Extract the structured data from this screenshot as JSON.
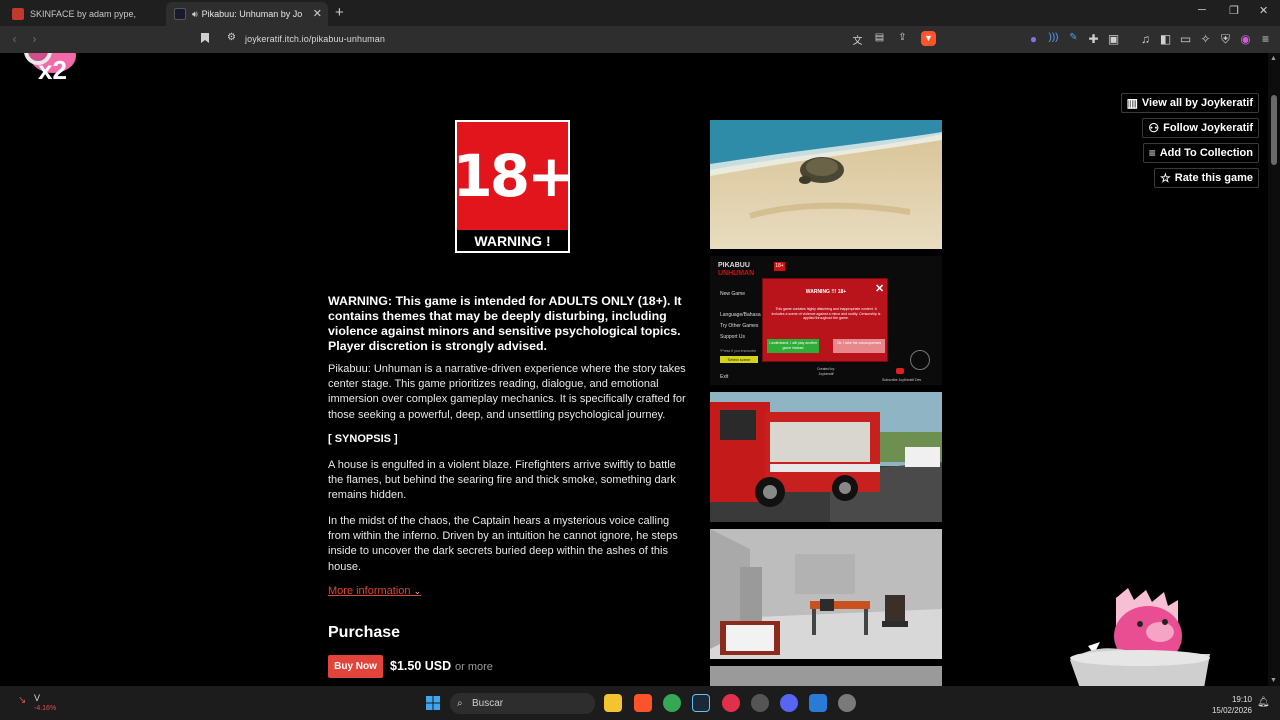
{
  "colors": {
    "tab_bg": "#1f1f1f",
    "toolbar_bg": "#2e2e2e",
    "page_bg": "#000000",
    "accent_red": "#e0443b",
    "warning_red": "#e1151b"
  },
  "browser": {
    "tabs": [
      {
        "title": "SKINFACE by adam pype, Ties Groen",
        "active": false,
        "icon": "itchio-icon"
      },
      {
        "title": "Pikabuu: Unhuman by Joykeratif",
        "active": true,
        "icon": "itchio-icon",
        "audio": true
      }
    ],
    "new_tab_label": "+",
    "url": "joykeratif.itch.io/pikabuu-unhuman"
  },
  "page": {
    "side_actions": [
      {
        "label": "View all by Joykeratif",
        "icon": "itchio-store-icon"
      },
      {
        "label": "Follow Joykeratif",
        "icon": "follow-user-icon"
      },
      {
        "label": "Add To Collection",
        "icon": "add-to-list-icon"
      },
      {
        "label": "Rate this game",
        "icon": "star-icon"
      }
    ],
    "warning_badge": {
      "big": "18+",
      "label": "WARNING !"
    },
    "warning_text": "WARNING: This game is intended for ADULTS ONLY (18+). It contains themes that may be deeply disturbing, including violence against minors and sensitive psychological topics. Player discretion is strongly advised.",
    "intro": "Pikabuu: Unhuman is a narrative-driven experience where the story takes center stage. This game prioritizes reading, dialogue, and emotional immersion over complex gameplay mechanics. It is specifically crafted for those seeking a powerful, deep, and unsettling psychological journey.",
    "synopsis_heading": "[ SYNOPSIS ]",
    "synopsis_1": "A house is engulfed in a violent blaze. Firefighters arrive swiftly to battle the flames, but behind the searing fire and thick smoke, something dark remains hidden.",
    "synopsis_2": "In the midst of the chaos, the Captain hears a mysterious voice calling from within the inferno. Driven by an intuition he cannot ignore, he steps inside to uncover the dark secrets buried deep within the ashes of this house.",
    "more_info": "More information",
    "purchase_heading": "Purchase",
    "buy_button": "Buy Now",
    "price": "$1.50 USD",
    "price_suffix": "or more",
    "screenshot_menu": {
      "logo_line1": "PIKABUU",
      "logo_line2": "UNHUMAN",
      "logo_badge": "18+",
      "menu_items": [
        "New Game",
        "Language/Bahasa",
        "Try Other Games",
        "Support Us"
      ],
      "popup_title": "WARNING !!! 18+",
      "popup_text": "This game contains highly disturbing and inappropriate content. It includes a scene of violence against a minor and nudity. Censorship is applied throughout the game.",
      "popup_btn_a": "I understand, I will play another game instead",
      "popup_btn_b": "Ok, I take the consequences",
      "exit_label": "Exit",
      "created_by": "Created by: Joykeratif",
      "subscribe": "Subscribe JoyKeratif Dev",
      "select_label": "Select scene",
      "press_hint": "*Press if you encounter"
    }
  },
  "taskbar": {
    "stock_symbol": "V",
    "stock_change": "-4.16%",
    "search_placeholder": "Buscar",
    "time": "19:10",
    "date": "15/02/2026"
  }
}
